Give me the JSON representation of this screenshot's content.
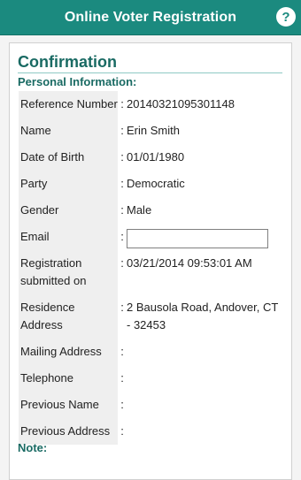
{
  "header": {
    "title": "Online Voter Registration",
    "help_icon": "?"
  },
  "confirmation": {
    "heading": "Confirmation",
    "subheading": "Personal Information:",
    "fields": [
      {
        "label": "Reference Number",
        "value": "20140321095301148"
      },
      {
        "label": "Name",
        "value": "Erin Smith"
      },
      {
        "label": "Date of Birth",
        "value": "01/01/1980"
      },
      {
        "label": "Party",
        "value": "Democratic"
      },
      {
        "label": "Gender",
        "value": "Male"
      },
      {
        "label": "Email",
        "value": ""
      },
      {
        "label": "Registration submitted on",
        "value": "03/21/2014 09:53:01 AM"
      },
      {
        "label": "Residence Address",
        "value": "2 Bausola Road, Andover, CT - 32453"
      },
      {
        "label": "Mailing Address",
        "value": ""
      },
      {
        "label": "Telephone",
        "value": ""
      },
      {
        "label": "Previous Name",
        "value": ""
      },
      {
        "label": "Previous Address",
        "value": ""
      }
    ],
    "separator": ":",
    "note_label": "Note:"
  },
  "colors": {
    "brand": "#1b8a7f",
    "heading": "#196a63",
    "label_bg": "#efefef"
  }
}
